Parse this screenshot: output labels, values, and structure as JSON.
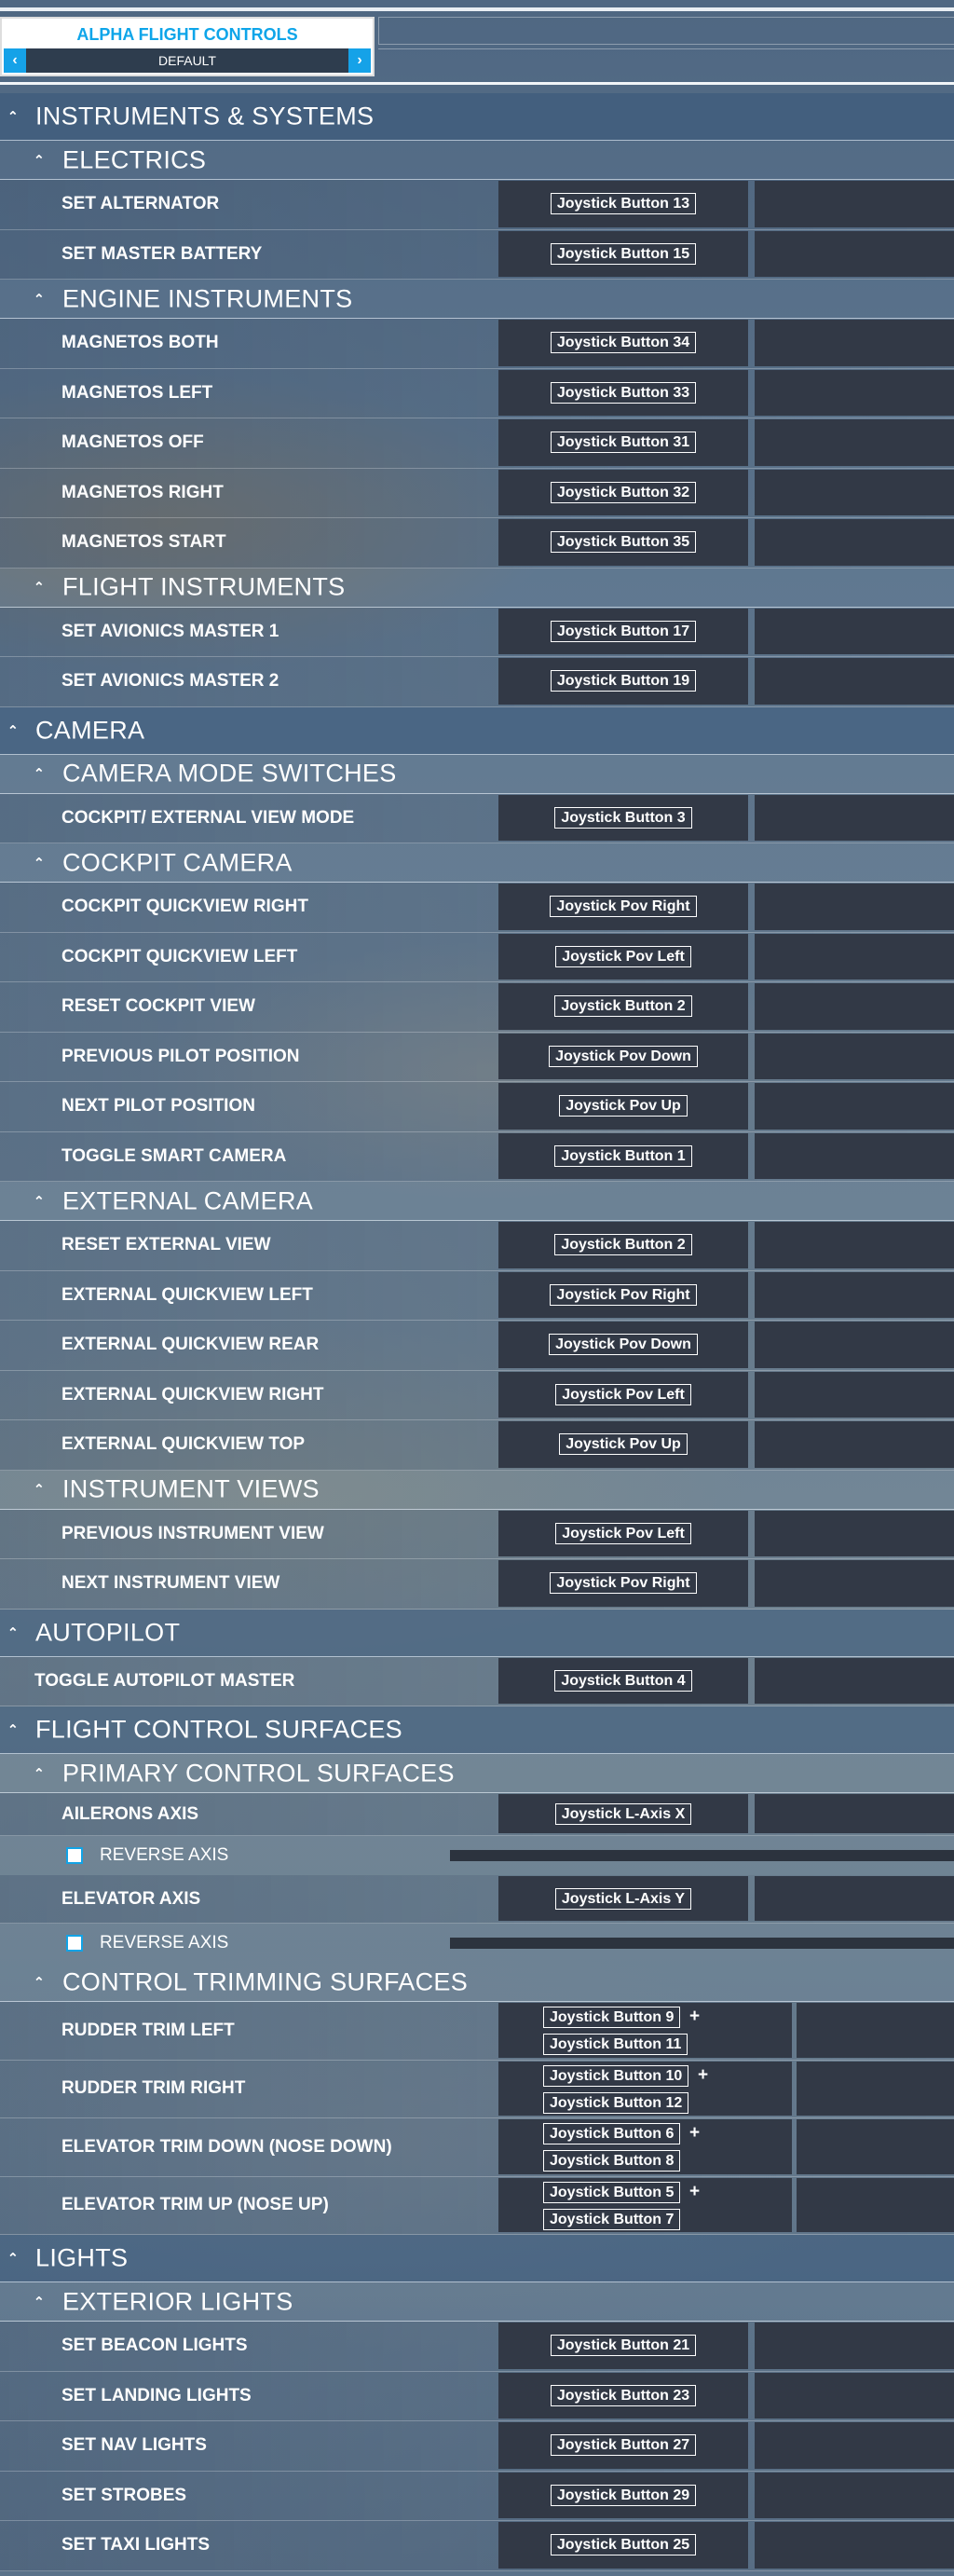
{
  "profile": {
    "title": "ALPHA FLIGHT CONTROLS",
    "preset": "DEFAULT"
  },
  "icons": {
    "prev": "chevron-left-icon",
    "next": "chevron-right-icon",
    "collapse": "chevron-up-icon"
  },
  "colors": {
    "accent": "#15a2e8",
    "slot": "#323946"
  },
  "sections": {
    "instruments": "INSTRUMENTS & SYSTEMS",
    "electrics": "ELECTRICS",
    "set_alternator": "SET ALTERNATOR",
    "set_alternator_key": "Joystick Button 13",
    "set_master_battery": "SET MASTER BATTERY",
    "set_master_battery_key": "Joystick Button 15",
    "engine_instruments": "ENGINE INSTRUMENTS",
    "magnetos_both": "MAGNETOS BOTH",
    "magnetos_both_key": "Joystick Button 34",
    "magnetos_left": "MAGNETOS LEFT",
    "magnetos_left_key": "Joystick Button 33",
    "magnetos_off": "MAGNETOS OFF",
    "magnetos_off_key": "Joystick Button 31",
    "magnetos_right": "MAGNETOS RIGHT",
    "magnetos_right_key": "Joystick Button 32",
    "magnetos_start": "MAGNETOS START",
    "magnetos_start_key": "Joystick Button 35",
    "flight_instruments": "FLIGHT INSTRUMENTS",
    "avionics1": "SET AVIONICS MASTER 1",
    "avionics1_key": "Joystick Button 17",
    "avionics2": "SET AVIONICS MASTER 2",
    "avionics2_key": "Joystick Button 19",
    "camera": "CAMERA",
    "camera_mode": "CAMERA MODE SWITCHES",
    "cockpit_ext": "COCKPIT/ EXTERNAL VIEW MODE",
    "cockpit_ext_key": "Joystick Button 3",
    "cockpit_camera": "COCKPIT CAMERA",
    "cqv_right": "COCKPIT QUICKVIEW RIGHT",
    "cqv_right_key": "Joystick Pov Right",
    "cqv_left": "COCKPIT QUICKVIEW LEFT",
    "cqv_left_key": "Joystick Pov Left",
    "reset_cockpit": "RESET COCKPIT VIEW",
    "reset_cockpit_key": "Joystick Button 2",
    "prev_pilot": "PREVIOUS PILOT POSITION",
    "prev_pilot_key": "Joystick Pov Down",
    "next_pilot": "NEXT PILOT POSITION",
    "next_pilot_key": "Joystick Pov Up",
    "smart_cam": "TOGGLE SMART CAMERA",
    "smart_cam_key": "Joystick Button 1",
    "external_camera": "EXTERNAL CAMERA",
    "reset_ext": "RESET EXTERNAL VIEW",
    "reset_ext_key": "Joystick Button 2",
    "eqv_left": "EXTERNAL QUICKVIEW LEFT",
    "eqv_left_key": "Joystick Pov Right",
    "eqv_rear": "EXTERNAL QUICKVIEW REAR",
    "eqv_rear_key": "Joystick Pov Down",
    "eqv_right": "EXTERNAL QUICKVIEW RIGHT",
    "eqv_right_key": "Joystick Pov Left",
    "eqv_top": "EXTERNAL QUICKVIEW TOP",
    "eqv_top_key": "Joystick Pov Up",
    "instrument_views": "INSTRUMENT VIEWS",
    "prev_instr": "PREVIOUS INSTRUMENT VIEW",
    "prev_instr_key": "Joystick Pov Left",
    "next_instr": "NEXT INSTRUMENT VIEW",
    "next_instr_key": "Joystick Pov Right",
    "autopilot": "AUTOPILOT",
    "ap_master": "TOGGLE AUTOPILOT MASTER",
    "ap_master_key": "Joystick Button 4",
    "fcs": "FLIGHT CONTROL SURFACES",
    "pcs": "PRIMARY CONTROL SURFACES",
    "ailerons": "AILERONS AXIS",
    "ailerons_key": "Joystick L-Axis X",
    "reverse_axis": "REVERSE AXIS",
    "elevator": "ELEVATOR AXIS",
    "elevator_key": "Joystick L-Axis Y",
    "cts": "CONTROL TRIMMING SURFACES",
    "rudder_left": "RUDDER TRIM LEFT",
    "rudder_left_k1": "Joystick Button 9",
    "rudder_left_k2": "Joystick Button 11",
    "rudder_right": "RUDDER TRIM RIGHT",
    "rudder_right_k1": "Joystick Button 10",
    "rudder_right_k2": "Joystick Button 12",
    "elev_down": "ELEVATOR TRIM DOWN (NOSE DOWN)",
    "elev_down_k1": "Joystick Button 6",
    "elev_down_k2": "Joystick Button 8",
    "elev_up": "ELEVATOR TRIM UP (NOSE UP)",
    "elev_up_k1": "Joystick Button 5",
    "elev_up_k2": "Joystick Button 7",
    "plus": "+",
    "lights": "LIGHTS",
    "exterior_lights": "EXTERIOR LIGHTS",
    "beacon": "SET BEACON LIGHTS",
    "beacon_key": "Joystick Button 21",
    "landing": "SET LANDING LIGHTS",
    "landing_key": "Joystick Button 23",
    "nav": "SET NAV LIGHTS",
    "nav_key": "Joystick Button 27",
    "strobes": "SET STROBES",
    "strobes_key": "Joystick Button 29",
    "taxi": "SET TAXI LIGHTS",
    "taxi_key": "Joystick Button 25"
  }
}
